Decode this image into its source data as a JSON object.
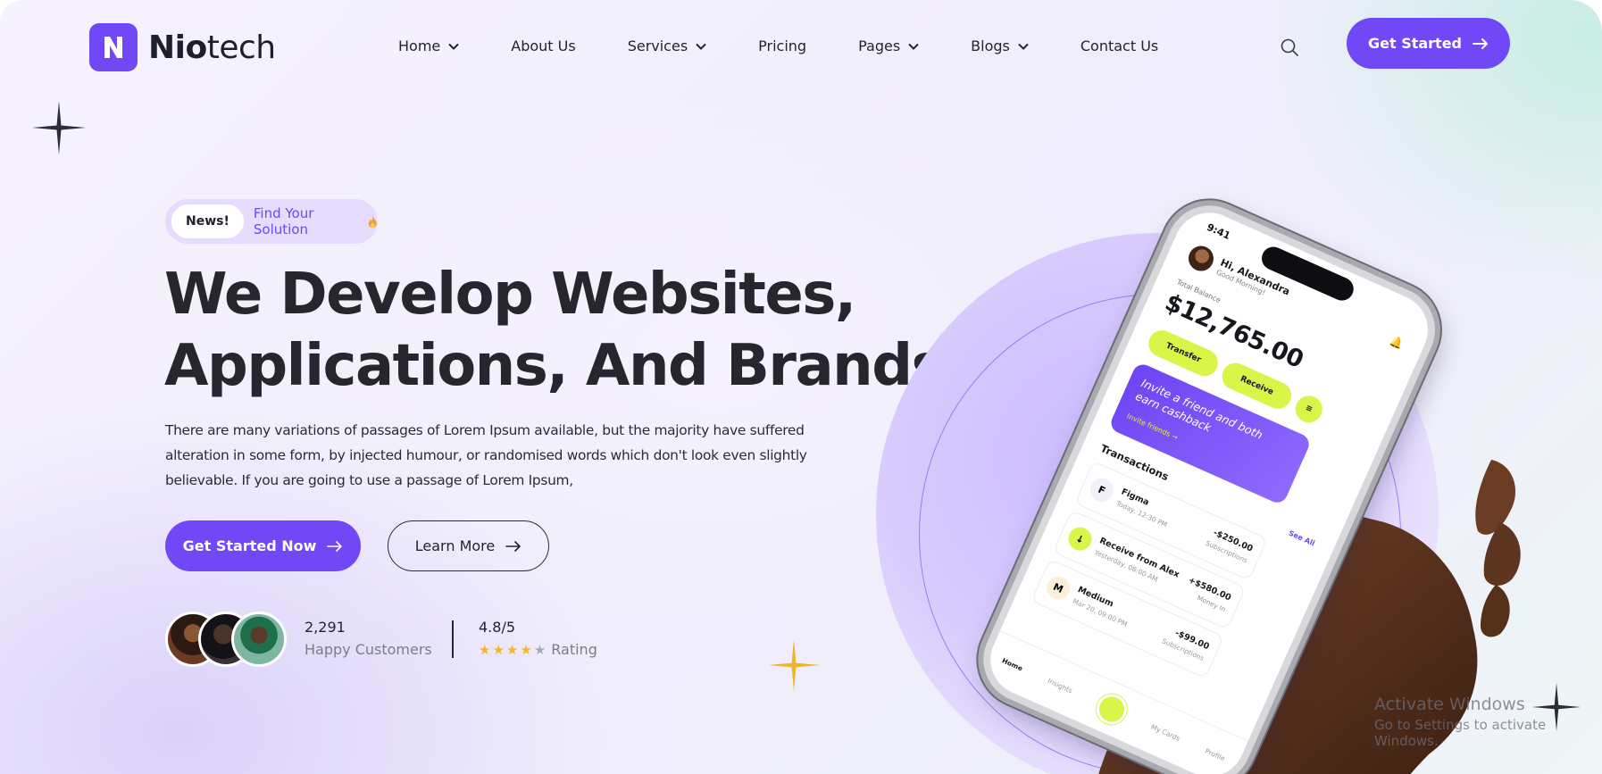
{
  "brand": {
    "logo_letter": "N",
    "name_bold": "Nio",
    "name_light": "tech",
    "accent_color": "#7048f5",
    "lime_color": "#d8f548"
  },
  "nav": {
    "items": [
      {
        "label": "Home",
        "dropdown": true
      },
      {
        "label": "About Us",
        "dropdown": false
      },
      {
        "label": "Services",
        "dropdown": true
      },
      {
        "label": "Pricing",
        "dropdown": false
      },
      {
        "label": "Pages",
        "dropdown": true
      },
      {
        "label": "Blogs",
        "dropdown": true
      },
      {
        "label": "Contact Us",
        "dropdown": false
      }
    ],
    "search_icon": "search-icon",
    "cta_label": "Get Started"
  },
  "hero": {
    "news_tag": "News!",
    "news_text": "Find Your Solution",
    "news_icon": "fire-icon",
    "title_line1": "We Develop Websites,",
    "title_line2": "Applications, And Brands.",
    "description": "There are many variations of passages of Lorem Ipsum available, but the majority have suffered alteration in some form, by injected humour, or randomised words which don't look even slightly believable. If you are going to use a passage of Lorem Ipsum,",
    "primary_button": "Get Started Now",
    "secondary_button": "Learn More"
  },
  "stats": {
    "customers_count": "2,291",
    "customers_label": "Happy Customers",
    "rating_value": "4.8/5",
    "rating_label": "Rating",
    "stars_filled": 4,
    "stars_total": 5
  },
  "phone": {
    "time": "9:41",
    "greeting_name": "Hi, Alexandra",
    "greeting_sub": "Good Morning!",
    "balance_label": "Total Balance",
    "balance": "$12,765.00",
    "transfer_label": "Transfer",
    "receive_label": "Receive",
    "invite_text": "Invite a friend and both earn cashback",
    "invite_link": "Invite friends →",
    "transactions_title": "Transactions",
    "see_all": "See All",
    "transactions": [
      {
        "name": "Figma",
        "date": "Today, 12:30 PM",
        "amount": "-$250.00",
        "type": "Subscriptions",
        "icon": "F"
      },
      {
        "name": "Receive from Alex",
        "date": "Yesterday, 08:00 AM",
        "amount": "+$580.00",
        "type": "Money In",
        "icon": "↓"
      },
      {
        "name": "Medium",
        "date": "Mar 20, 09:00 PM",
        "amount": "-$99.00",
        "type": "Subscriptions",
        "icon": "M"
      }
    ],
    "tabs": [
      "Home",
      "Insights",
      "",
      "My Cards",
      "Profile"
    ]
  },
  "watermark": {
    "title": "Activate Windows",
    "subtitle": "Go to Settings to activate Windows."
  }
}
